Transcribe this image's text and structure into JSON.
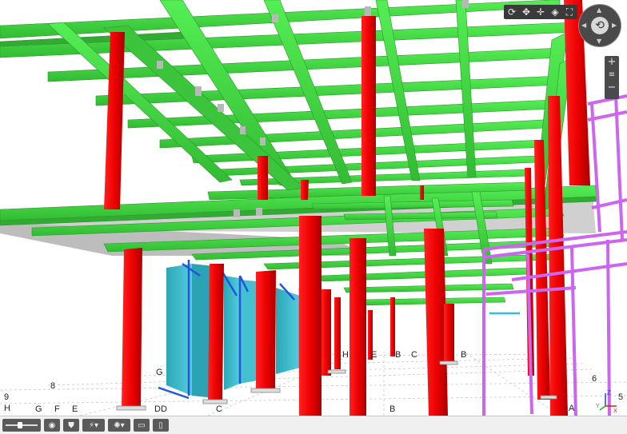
{
  "viewer": {
    "toolbar": {
      "icons": [
        "orbit-icon",
        "pan-icon",
        "move-icon",
        "section-icon",
        "fit-icon"
      ]
    },
    "navwheel": {
      "icon": "orbit-icon"
    },
    "zoom": {
      "plus": "+",
      "minus": "−"
    }
  },
  "grid_labels": [
    {
      "text": "H"
    },
    {
      "text": "G"
    },
    {
      "text": "F"
    },
    {
      "text": "E"
    },
    {
      "text": "8"
    },
    {
      "text": "9"
    },
    {
      "text": "G"
    },
    {
      "text": "DD"
    },
    {
      "text": "C"
    },
    {
      "text": "B"
    },
    {
      "text": "H"
    },
    {
      "text": "E"
    },
    {
      "text": "B"
    },
    {
      "text": "C"
    },
    {
      "text": "B"
    },
    {
      "text": "6"
    },
    {
      "text": "A"
    },
    {
      "text": "5"
    }
  ],
  "axis": {
    "x": "X",
    "y": "Y",
    "z": "Z"
  },
  "bottom_bar": {
    "buttons": [
      "slider",
      "eye-icon",
      "shield-icon",
      "lightning-icon",
      "render-icon",
      "comment-icon",
      "document-icon"
    ]
  },
  "colors": {
    "beam": "#44dd44",
    "column": "#ee0000",
    "frame": "#cc66ee",
    "panel": "#33bbcc",
    "brace": "#2255dd",
    "slab": "#c8c8c8"
  }
}
